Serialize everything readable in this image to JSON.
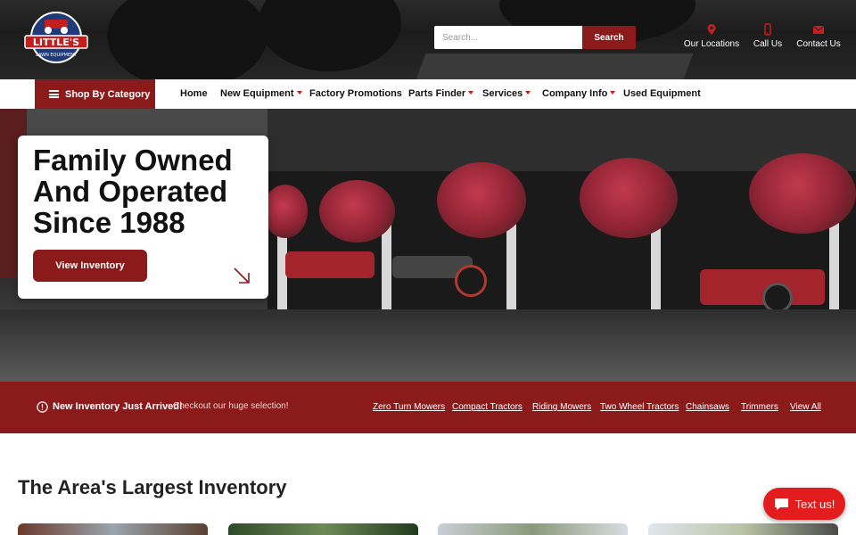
{
  "logo": {
    "name": "LITTLE'S",
    "tagline": "LAWN EQUIPMENT"
  },
  "search": {
    "placeholder": "Search...",
    "button_label": "Search"
  },
  "utility": {
    "locations": "Our Locations",
    "call": "Call Us",
    "contact": "Contact Us"
  },
  "nav": {
    "shop_by_category": "Shop By Category",
    "items": [
      {
        "label": "Home",
        "dropdown": false
      },
      {
        "label": "New Equipment",
        "dropdown": true
      },
      {
        "label": "Factory Promotions",
        "dropdown": false
      },
      {
        "label": "Parts Finder",
        "dropdown": true
      },
      {
        "label": "Services",
        "dropdown": true
      },
      {
        "label": "Company Info",
        "dropdown": true
      },
      {
        "label": "Used Equipment",
        "dropdown": false
      }
    ]
  },
  "hero": {
    "title": "Family Owned\nAnd Operated\nSince 1988",
    "button_label": "View Inventory"
  },
  "banner": {
    "title": "New Inventory Just Arrived!",
    "subtitle": "Checkout our huge selection!",
    "links": [
      "Zero Turn Mowers",
      "Compact Tractors",
      "Riding Mowers",
      "Two Wheel Tractors",
      "Chainsaws",
      "Trimmers",
      "View All"
    ]
  },
  "inventory": {
    "heading": "The Area's Largest Inventory"
  },
  "chat": {
    "label": "Text us!"
  },
  "colors": {
    "brand_red": "#8b1a1a",
    "chat_red": "#e31d1d",
    "caret_red": "#c41e1e"
  },
  "icons": {
    "locations": "map-pin-icon",
    "call": "phone-icon",
    "contact": "envelope-icon",
    "shop": "hamburger-icon",
    "banner": "alert-circle-icon",
    "hero": "arrow-down-right-icon",
    "chat": "chat-bubble-icon"
  }
}
